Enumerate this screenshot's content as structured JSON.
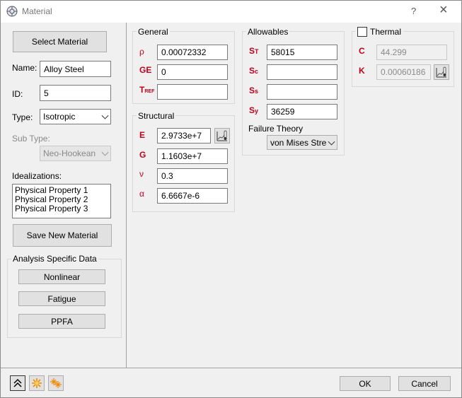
{
  "window": {
    "title": "Material",
    "help_icon": "?",
    "close_icon": "×"
  },
  "left": {
    "select_material": "Select Material",
    "name_label": "Name:",
    "name_value": "Alloy Steel",
    "id_label": "ID:",
    "id_value": "5",
    "type_label": "Type:",
    "type_value": "Isotropic",
    "subtype_label": "Sub Type:",
    "subtype_value": "Neo-Hookean",
    "idealizations_label": "Idealizations:",
    "idealizations": [
      "Physical Property 1",
      "Physical Property 2",
      "Physical Property 3"
    ],
    "save_new": "Save New Material",
    "analysis_title": "Analysis Specific Data",
    "nonlinear": "Nonlinear",
    "fatigue": "Fatigue",
    "ppfa": "PPFA"
  },
  "general": {
    "title": "General",
    "rho_symbol": "ρ",
    "rho_value": "0.00072332",
    "ge_symbol": "GE",
    "ge_value": "0",
    "tref_symbol": "T",
    "tref_sub": "REF",
    "tref_value": ""
  },
  "structural": {
    "title": "Structural",
    "e_symbol": "E",
    "e_value": "2.9733e+7",
    "g_symbol": "G",
    "g_value": "1.1603e+7",
    "nu_symbol": "ν",
    "nu_value": "0.3",
    "alpha_symbol": "α",
    "alpha_value": "6.6667e-6"
  },
  "allowables": {
    "title": "Allowables",
    "st_symbol": "S",
    "st_sub": "T",
    "st_value": "58015",
    "sc_symbol": "S",
    "sc_sub": "c",
    "sc_value": "",
    "ss_symbol": "S",
    "ss_sub": "s",
    "ss_value": "",
    "sy_symbol": "S",
    "sy_sub": "y",
    "sy_value": "36259",
    "failure_label": "Failure Theory",
    "failure_value": "von Mises Stress"
  },
  "thermal": {
    "title": "Thermal",
    "checked": false,
    "c_symbol": "C",
    "c_value": "44.299",
    "k_symbol": "K",
    "k_value": "0.00060186"
  },
  "footer": {
    "ok": "OK",
    "cancel": "Cancel"
  },
  "colors": {
    "accent_red": "#c0001a",
    "background": "#f0f0f0"
  }
}
